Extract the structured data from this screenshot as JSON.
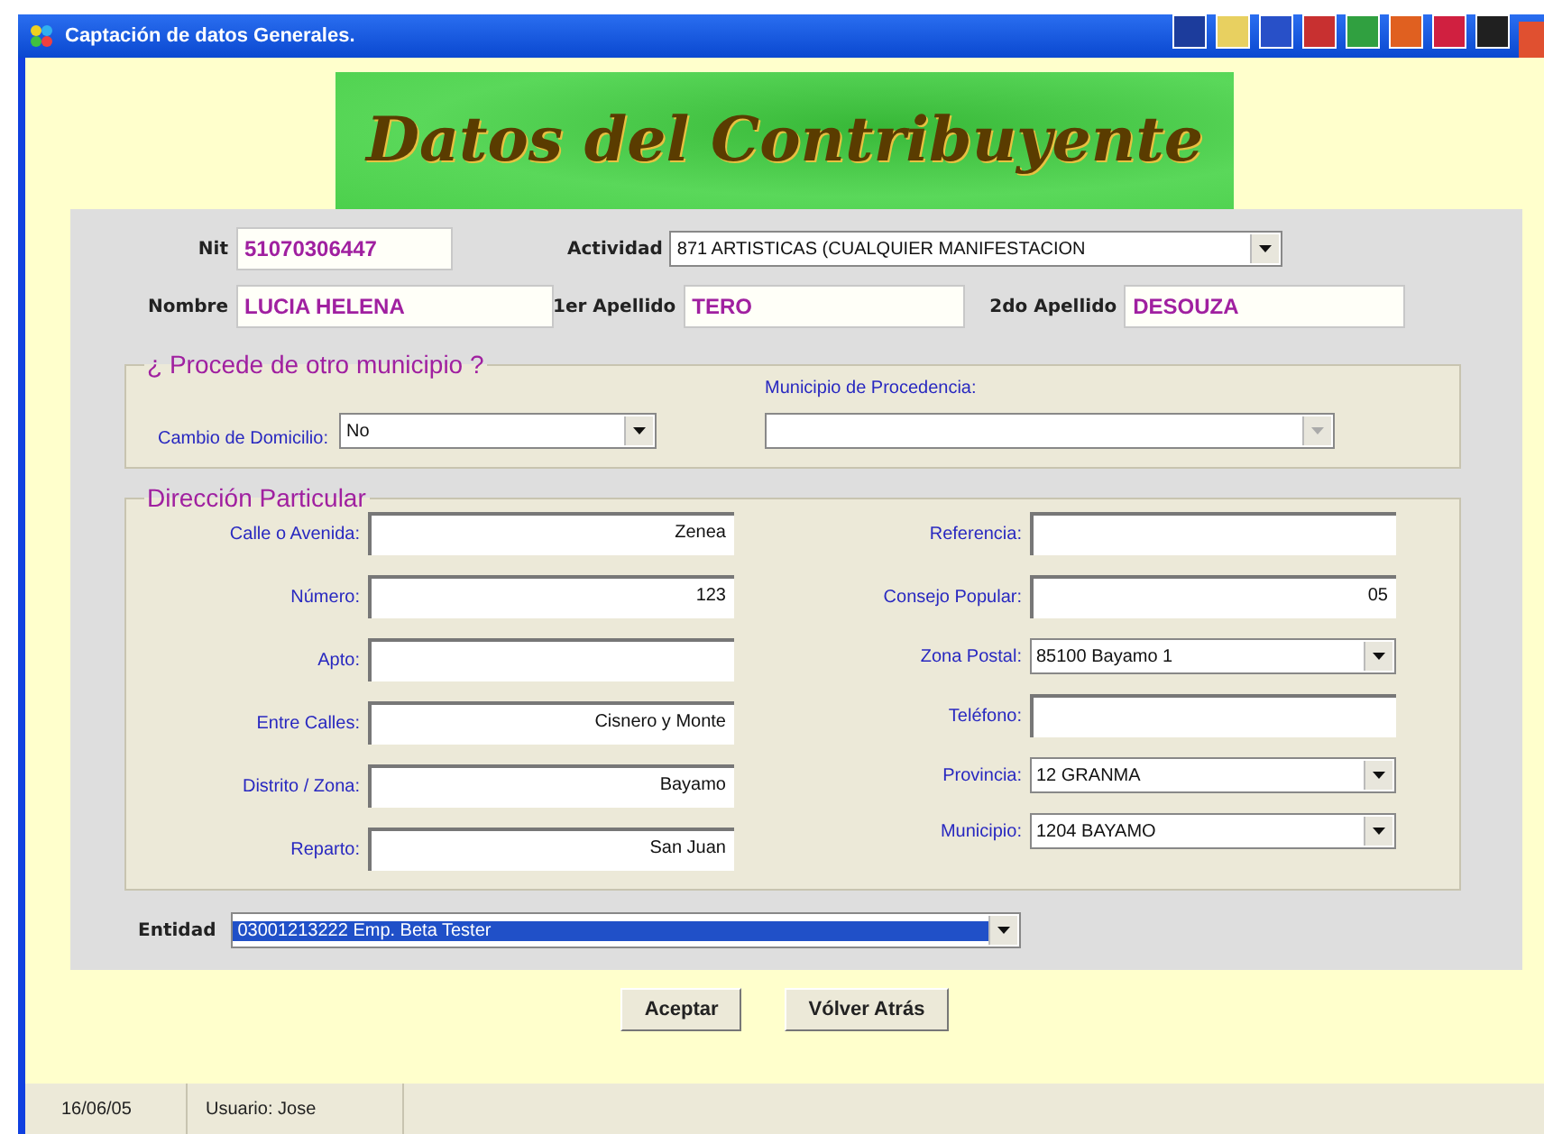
{
  "window": {
    "title": "Captación de datos Generales."
  },
  "banner": {
    "title": "Datos del Contribuyente"
  },
  "header": {
    "nit": {
      "label": "Nit",
      "value": "51070306447"
    },
    "actividad": {
      "label": "Actividad",
      "value": "871 ARTISTICAS (CUALQUIER MANIFESTACION"
    },
    "nombre": {
      "label": "Nombre",
      "value": "LUCIA HELENA"
    },
    "apellido1": {
      "label": "1er Apellido",
      "value": "TERO"
    },
    "apellido2": {
      "label": "2do Apellido",
      "value": "DESOUZA"
    }
  },
  "procedencia": {
    "title": "¿ Procede de otro municipio ?",
    "cambio": {
      "label": "Cambio de Domicilio:",
      "value": "No"
    },
    "municipio": {
      "label": "Municipio de Procedencia:",
      "disabled": true
    }
  },
  "direccion": {
    "title": "Dirección Particular",
    "left": [
      {
        "kind": "text",
        "label": "Calle o Avenida:",
        "value": "Zenea"
      },
      {
        "kind": "text",
        "label": "Número:",
        "value": "123"
      },
      {
        "kind": "text",
        "label": "Apto:"
      },
      {
        "kind": "text",
        "label": "Entre Calles:",
        "value": "Cisnero y Monte"
      },
      {
        "kind": "text",
        "label": "Distrito / Zona:",
        "value": "Bayamo"
      },
      {
        "kind": "text",
        "label": "Reparto:",
        "value": "San Juan"
      }
    ],
    "right": [
      {
        "kind": "text",
        "label": "Referencia:"
      },
      {
        "kind": "text",
        "label": "Consejo Popular:",
        "value": "05"
      },
      {
        "kind": "dropdown",
        "label": "Zona Postal:",
        "value": "85100  Bayamo 1"
      },
      {
        "kind": "text",
        "label": "Teléfono:"
      },
      {
        "kind": "dropdown",
        "label": "Provincia:",
        "value": "12  GRANMA"
      },
      {
        "kind": "dropdown",
        "label": "Municipio:",
        "value": "1204  BAYAMO"
      }
    ]
  },
  "entidad": {
    "label": "Entidad",
    "value": "03001213222  Emp. Beta Tester",
    "selected": true
  },
  "buttons": [
    "Aceptar",
    "Vólver Atrás"
  ],
  "status_bar": [
    "16/06/05",
    "Usuario: Jose"
  ]
}
